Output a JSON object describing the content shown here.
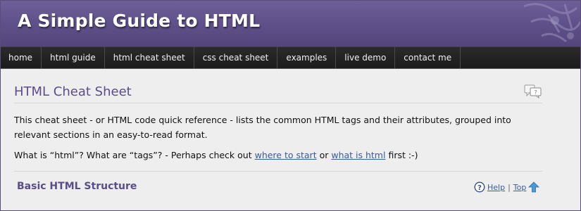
{
  "header": {
    "site_title": "A Simple Guide to HTML"
  },
  "nav": {
    "items": [
      {
        "label": "home"
      },
      {
        "label": "html guide"
      },
      {
        "label": "html cheat sheet"
      },
      {
        "label": "css cheat sheet"
      },
      {
        "label": "examples"
      },
      {
        "label": "live demo"
      },
      {
        "label": "contact me"
      }
    ]
  },
  "main": {
    "page_title": "HTML Cheat Sheet",
    "intro": "This cheat sheet - or HTML code quick reference - lists the common HTML tags and their attributes, grouped into relevant sections in an easy-to-read format.",
    "question_prefix": "What is “html”? What are “tags”? - Perhaps check out ",
    "link_where_to_start": "where to start",
    "question_or": " or ",
    "link_what_is_html": "what is html",
    "question_suffix": " first :-)",
    "section": {
      "title": "Basic HTML Structure",
      "help_label": "Help",
      "separator": "|",
      "top_label": "Top"
    }
  },
  "icons": {
    "comment": "comment-bubble-icon",
    "help": "help-question-icon",
    "top": "arrow-up-icon"
  },
  "colors": {
    "banner": "#5e4f88",
    "nav": "#1f1f1f",
    "heading": "#5b4d8a",
    "link": "#3b5b9a"
  }
}
